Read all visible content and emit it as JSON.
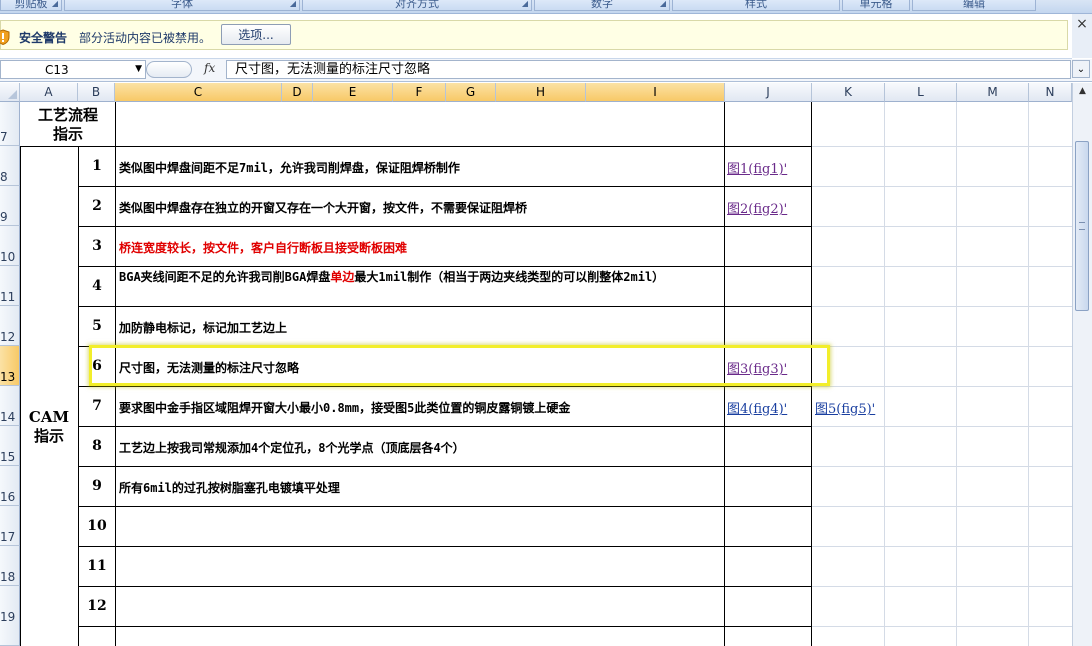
{
  "ribbon": {
    "groups": [
      "剪贴板",
      "字体",
      "对齐方式",
      "数字",
      "样式",
      "单元格",
      "编辑"
    ]
  },
  "security_bar": {
    "title": "安全警告",
    "message": "部分活动内容已被禁用。",
    "options_button": "选项...",
    "close_glyph": "×"
  },
  "formula_bar": {
    "name_box": "C13",
    "fx_label": "fx",
    "content": "尺寸图，无法测量的标注尺寸忽略"
  },
  "columns": [
    "A",
    "B",
    "C",
    "D",
    "E",
    "F",
    "G",
    "H",
    "I",
    "J",
    "K",
    "L",
    "M",
    "N"
  ],
  "selected_column": "C",
  "row_numbers": [
    "7",
    "8",
    "9",
    "10",
    "11",
    "12",
    "13",
    "14",
    "15",
    "16",
    "17",
    "18",
    "19"
  ],
  "selected_row": "13",
  "sheet": {
    "process_label": "工艺流程\n指示",
    "cam_label": "CAM\n指示",
    "items": [
      {
        "num": "1",
        "text": "类似图中焊盘间距不足7mil，允许我司削焊盘，保证阻焊桥制作",
        "style": "normal",
        "links": [
          "图1(fig1)'"
        ]
      },
      {
        "num": "2",
        "text": "类似图中焊盘存在独立的开窗又存在一个大开窗，按文件，不需要保证阻焊桥",
        "style": "normal",
        "links": [
          "图2(fig2)'"
        ]
      },
      {
        "num": "3",
        "text": "桥连宽度较长，按文件，客户自行断板且接受断板困难",
        "style": "red",
        "links": []
      },
      {
        "num": "4",
        "text_parts": [
          "BGA夹线间距不足的允许我司削BGA焊盘",
          "单边",
          "最大1mil制作（相当于两边夹线类型的可以削整体2mil）"
        ],
        "style": "mixed",
        "links": []
      },
      {
        "num": "5",
        "text": "加防静电标记，标记加工艺边上",
        "style": "normal",
        "links": []
      },
      {
        "num": "6",
        "text": "尺寸图，无法测量的标注尺寸忽略",
        "style": "normal",
        "links": [
          "图3(fig3)'"
        ]
      },
      {
        "num": "7",
        "text": "要求图中金手指区域阻焊开窗大小最小0.8mm，接受图5此类位置的铜皮露铜镀上硬金",
        "style": "normal",
        "links": [
          "图4(fig4)'",
          "图5(fig5)'"
        ]
      },
      {
        "num": "8",
        "text": "工艺边上按我司常规添加4个定位孔，8个光学点（顶底层各4个）",
        "style": "normal",
        "links": []
      },
      {
        "num": "9",
        "text": "所有6mil的过孔按树脂塞孔电镀填平处理",
        "style": "normal",
        "links": []
      },
      {
        "num": "10",
        "text": "",
        "style": "normal",
        "links": []
      },
      {
        "num": "11",
        "text": "",
        "style": "normal",
        "links": []
      },
      {
        "num": "12",
        "text": "",
        "style": "normal",
        "links": []
      }
    ]
  },
  "colors": {
    "accent_highlight": "#f2ee2a",
    "red_text": "#e00000",
    "visited_link": "#6a2a8a",
    "link": "#1a3fa0",
    "selected_header": "#f8c967"
  }
}
